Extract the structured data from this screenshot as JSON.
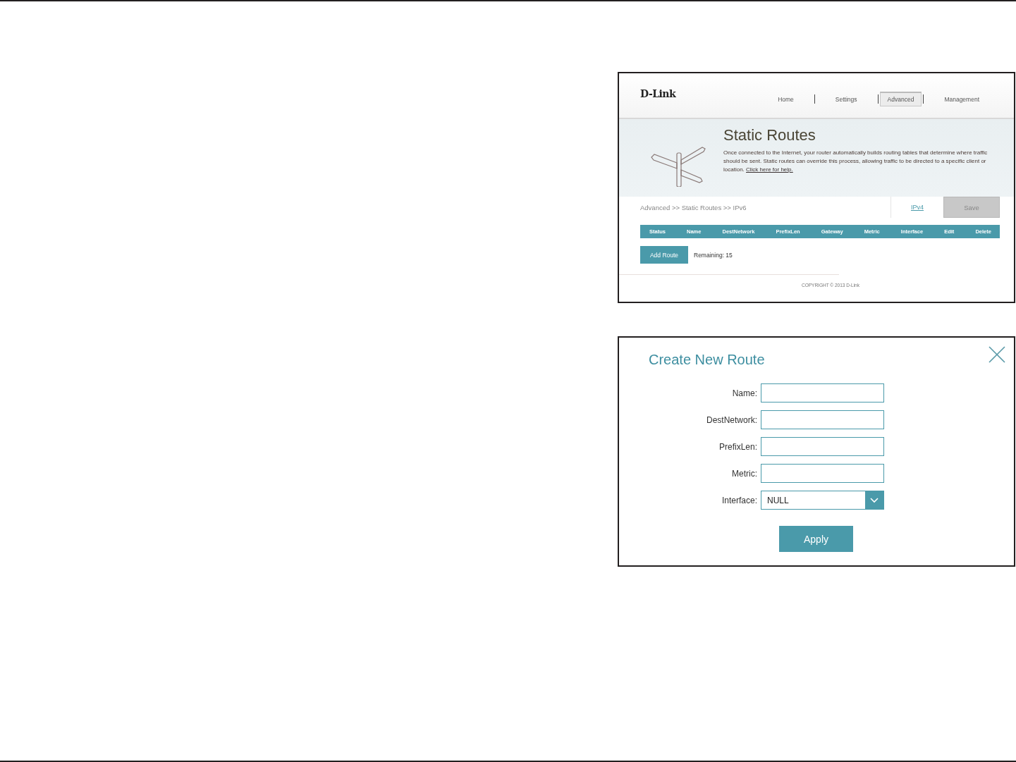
{
  "router_page": {
    "logo": "D-Link",
    "nav": [
      {
        "label": "Home",
        "selected": false
      },
      {
        "label": "Settings",
        "selected": false
      },
      {
        "label": "Advanced",
        "selected": true
      },
      {
        "label": "Management",
        "selected": false
      }
    ],
    "banner": {
      "title": "Static Routes",
      "description": "Once connected to the Internet, your router automatically builds routing tables that determine where traffic should be sent. Static routes can override this process, allowing traffic to be directed to a specific client or location.",
      "help_link": "Click here for help."
    },
    "breadcrumb": "Advanced >> Static Routes >> IPv6",
    "ipv4_link": "IPv4",
    "save_button": {
      "label": "Save",
      "disabled": true
    },
    "table": {
      "columns": [
        "Status",
        "Name",
        "DestNetwork",
        "PrefixLen",
        "Gateway",
        "Metric",
        "Interface",
        "Edit",
        "Delete"
      ]
    },
    "add_route_button": "Add Route",
    "remaining": "Remaining: 15",
    "copyright": "COPYRIGHT © 2013 D-Link"
  },
  "dialog": {
    "title": "Create New Route",
    "fields": [
      {
        "label": "Name:",
        "kind": "text"
      },
      {
        "label": "DestNetwork:",
        "kind": "text"
      },
      {
        "label": "PrefixLen:",
        "kind": "text"
      },
      {
        "label": "Metric:",
        "kind": "text"
      },
      {
        "label": "Interface:",
        "kind": "select",
        "value": "NULL"
      }
    ],
    "apply_button": "Apply"
  }
}
